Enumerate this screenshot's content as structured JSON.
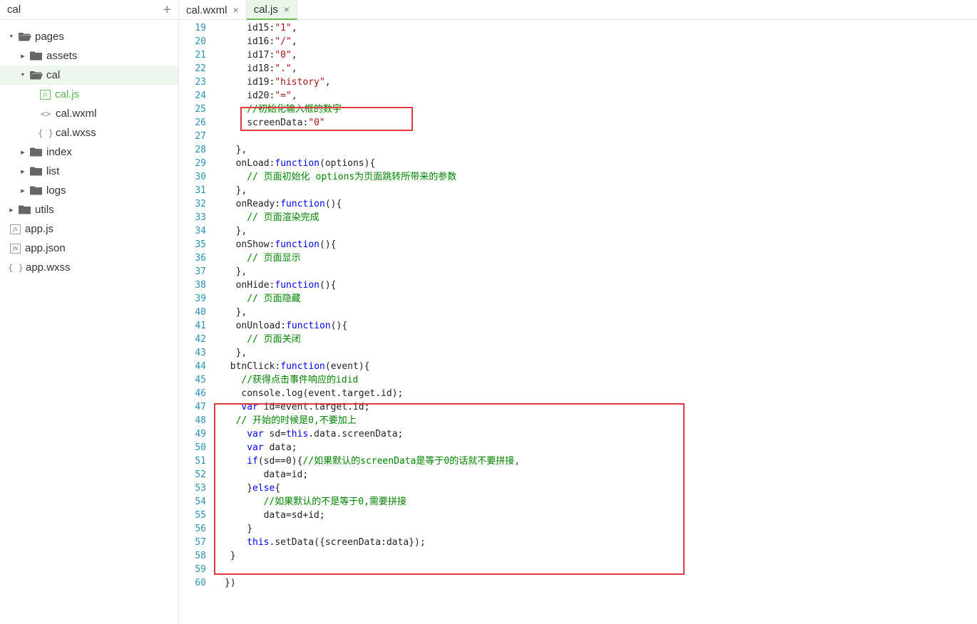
{
  "sidebar": {
    "title": "cal",
    "add_icon": "plus-icon",
    "tree": [
      {
        "label": "pages",
        "type": "folder",
        "open": true,
        "depth": 0
      },
      {
        "label": "assets",
        "type": "folder",
        "open": false,
        "depth": 1
      },
      {
        "label": "cal",
        "type": "folder",
        "open": true,
        "depth": 1,
        "selected": true
      },
      {
        "label": "cal.js",
        "type": "js",
        "depth": 2,
        "active": true,
        "badge": "JS"
      },
      {
        "label": "cal.wxml",
        "type": "wxml",
        "depth": 2,
        "glyph": "<>"
      },
      {
        "label": "cal.wxss",
        "type": "wxss",
        "depth": 2,
        "glyph": "{ }"
      },
      {
        "label": "index",
        "type": "folder",
        "open": false,
        "depth": 1
      },
      {
        "label": "list",
        "type": "folder",
        "open": false,
        "depth": 1
      },
      {
        "label": "logs",
        "type": "folder",
        "open": false,
        "depth": 1
      },
      {
        "label": "utils",
        "type": "folder",
        "open": false,
        "depth": 0
      },
      {
        "label": "app.js",
        "type": "js",
        "depth": 0,
        "badge": "JS"
      },
      {
        "label": "app.json",
        "type": "json",
        "depth": 0,
        "badge": "JN"
      },
      {
        "label": "app.wxss",
        "type": "wxss",
        "depth": 0,
        "glyph": "{ }"
      }
    ]
  },
  "tabs": [
    {
      "label": "cal.wxml",
      "close": "×",
      "active": false
    },
    {
      "label": "cal.js",
      "close": "×",
      "active": true
    }
  ],
  "editor": {
    "lines": [
      {
        "n": "19",
        "indent": 4,
        "tokens": [
          [
            "t",
            "id15:"
          ],
          [
            "s",
            "\"1\""
          ],
          [
            "t",
            ","
          ]
        ]
      },
      {
        "n": "20",
        "indent": 4,
        "tokens": [
          [
            "t",
            "id16:"
          ],
          [
            "s",
            "\"/\""
          ],
          [
            "t",
            ","
          ]
        ]
      },
      {
        "n": "21",
        "indent": 4,
        "tokens": [
          [
            "t",
            "id17:"
          ],
          [
            "s",
            "\"0\""
          ],
          [
            "t",
            ","
          ]
        ]
      },
      {
        "n": "22",
        "indent": 4,
        "tokens": [
          [
            "t",
            "id18:"
          ],
          [
            "s",
            "\".\""
          ],
          [
            "t",
            ","
          ]
        ]
      },
      {
        "n": "23",
        "indent": 4,
        "tokens": [
          [
            "t",
            "id19:"
          ],
          [
            "s",
            "\"history\""
          ],
          [
            "t",
            ","
          ]
        ]
      },
      {
        "n": "24",
        "indent": 4,
        "tokens": [
          [
            "t",
            "id20:"
          ],
          [
            "s",
            "\"=\""
          ],
          [
            "t",
            ","
          ]
        ]
      },
      {
        "n": "25",
        "indent": 4,
        "tokens": [
          [
            "c",
            "//初始化输入框的数字"
          ]
        ]
      },
      {
        "n": "26",
        "indent": 4,
        "tokens": [
          [
            "t",
            "screenData:"
          ],
          [
            "s",
            "\"0\""
          ]
        ]
      },
      {
        "n": "27",
        "indent": 0,
        "tokens": []
      },
      {
        "n": "28",
        "indent": 2,
        "tokens": [
          [
            "t",
            "},"
          ]
        ]
      },
      {
        "n": "29",
        "indent": 2,
        "tokens": [
          [
            "t",
            "onLoad:"
          ],
          [
            "k",
            "function"
          ],
          [
            "t",
            "(options){"
          ]
        ]
      },
      {
        "n": "30",
        "indent": 4,
        "tokens": [
          [
            "c",
            "// 页面初始化 options为页面跳转所带来的参数"
          ]
        ]
      },
      {
        "n": "31",
        "indent": 2,
        "tokens": [
          [
            "t",
            "},"
          ]
        ]
      },
      {
        "n": "32",
        "indent": 2,
        "tokens": [
          [
            "t",
            "onReady:"
          ],
          [
            "k",
            "function"
          ],
          [
            "t",
            "(){"
          ]
        ]
      },
      {
        "n": "33",
        "indent": 4,
        "tokens": [
          [
            "c",
            "// 页面渲染完成"
          ]
        ]
      },
      {
        "n": "34",
        "indent": 2,
        "tokens": [
          [
            "t",
            "},"
          ]
        ]
      },
      {
        "n": "35",
        "indent": 2,
        "tokens": [
          [
            "t",
            "onShow:"
          ],
          [
            "k",
            "function"
          ],
          [
            "t",
            "(){"
          ]
        ]
      },
      {
        "n": "36",
        "indent": 4,
        "tokens": [
          [
            "c",
            "// 页面显示"
          ]
        ]
      },
      {
        "n": "37",
        "indent": 2,
        "tokens": [
          [
            "t",
            "},"
          ]
        ]
      },
      {
        "n": "38",
        "indent": 2,
        "tokens": [
          [
            "t",
            "onHide:"
          ],
          [
            "k",
            "function"
          ],
          [
            "t",
            "(){"
          ]
        ]
      },
      {
        "n": "39",
        "indent": 4,
        "tokens": [
          [
            "c",
            "// 页面隐藏"
          ]
        ]
      },
      {
        "n": "40",
        "indent": 2,
        "tokens": [
          [
            "t",
            "},"
          ]
        ]
      },
      {
        "n": "41",
        "indent": 2,
        "tokens": [
          [
            "t",
            "onUnload:"
          ],
          [
            "k",
            "function"
          ],
          [
            "t",
            "(){"
          ]
        ]
      },
      {
        "n": "42",
        "indent": 4,
        "tokens": [
          [
            "c",
            "// 页面关闭"
          ]
        ]
      },
      {
        "n": "43",
        "indent": 2,
        "tokens": [
          [
            "t",
            "},"
          ]
        ]
      },
      {
        "n": "44",
        "indent": 1,
        "tokens": [
          [
            "t",
            "btnClick:"
          ],
          [
            "k",
            "function"
          ],
          [
            "t",
            "(event){"
          ]
        ]
      },
      {
        "n": "45",
        "indent": 3,
        "tokens": [
          [
            "c",
            "//获得点击事件响应的idid"
          ]
        ]
      },
      {
        "n": "46",
        "indent": 3,
        "tokens": [
          [
            "t",
            "console.log(event.target.id);"
          ]
        ]
      },
      {
        "n": "47",
        "indent": 3,
        "tokens": [
          [
            "k",
            "var"
          ],
          [
            "t",
            " id=event.target.id;"
          ]
        ]
      },
      {
        "n": "48",
        "indent": 2,
        "tokens": [
          [
            "c",
            "// 开始的时候是0,不要加上"
          ]
        ]
      },
      {
        "n": "49",
        "indent": 4,
        "tokens": [
          [
            "k",
            "var"
          ],
          [
            "t",
            " sd="
          ],
          [
            "k",
            "this"
          ],
          [
            "t",
            ".data.screenData;"
          ]
        ]
      },
      {
        "n": "50",
        "indent": 4,
        "tokens": [
          [
            "k",
            "var"
          ],
          [
            "t",
            " data;"
          ]
        ]
      },
      {
        "n": "51",
        "indent": 4,
        "tokens": [
          [
            "k",
            "if"
          ],
          [
            "t",
            "(sd==0){"
          ],
          [
            "c",
            "//如果默认的screenData是等于0的话就不要拼接,"
          ]
        ]
      },
      {
        "n": "52",
        "indent": 7,
        "tokens": [
          [
            "t",
            "data=id;"
          ]
        ]
      },
      {
        "n": "53",
        "indent": 4,
        "tokens": [
          [
            "t",
            "}"
          ],
          [
            "k",
            "else"
          ],
          [
            "t",
            "{"
          ]
        ]
      },
      {
        "n": "54",
        "indent": 7,
        "tokens": [
          [
            "c",
            "//如果默认的不是等于0,需要拼接"
          ]
        ]
      },
      {
        "n": "55",
        "indent": 7,
        "tokens": [
          [
            "t",
            "data=sd+id;"
          ]
        ]
      },
      {
        "n": "56",
        "indent": 4,
        "tokens": [
          [
            "t",
            "}"
          ]
        ]
      },
      {
        "n": "57",
        "indent": 4,
        "tokens": [
          [
            "k",
            "this"
          ],
          [
            "t",
            ".setData({screenData:data});"
          ]
        ]
      },
      {
        "n": "58",
        "indent": 1,
        "tokens": [
          [
            "t",
            "}"
          ]
        ]
      },
      {
        "n": "59",
        "indent": 0,
        "tokens": []
      },
      {
        "n": "60",
        "indent": 0,
        "tokens": [
          [
            "t",
            "})"
          ]
        ]
      }
    ],
    "highlight_color": "#e03a3a"
  }
}
